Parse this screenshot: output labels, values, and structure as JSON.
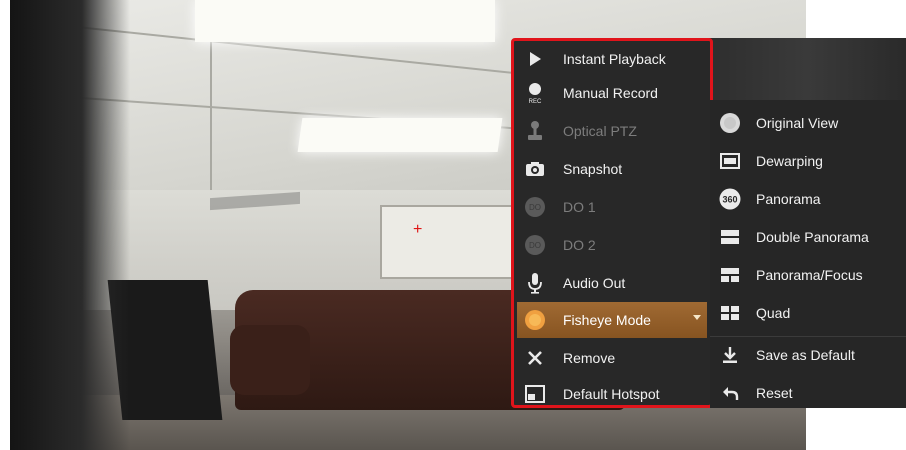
{
  "menu": {
    "items": [
      {
        "label": "Instant Playback",
        "icon": "play-icon",
        "enabled": true
      },
      {
        "label": "Manual Record",
        "icon": "record-icon",
        "icon_caption": "REC",
        "enabled": true
      },
      {
        "label": "Optical PTZ",
        "icon": "ptz-joystick-icon",
        "enabled": false
      },
      {
        "label": "Snapshot",
        "icon": "camera-icon",
        "enabled": true
      },
      {
        "label": "DO 1",
        "icon": "digital-output-icon",
        "enabled": false
      },
      {
        "label": "DO 2",
        "icon": "digital-output-icon",
        "enabled": false
      },
      {
        "label": "Audio Out",
        "icon": "microphone-icon",
        "enabled": true
      },
      {
        "label": "Fisheye Mode",
        "icon": "fisheye-icon",
        "enabled": true,
        "active": true,
        "has_submenu": true
      },
      {
        "label": "Remove",
        "icon": "close-icon",
        "enabled": true
      },
      {
        "label": "Default Hotspot",
        "icon": "hotspot-icon",
        "enabled": true
      }
    ],
    "highlight_color": "#e0141b",
    "active_color": "#9a6430"
  },
  "submenu": {
    "items": [
      {
        "label": "Original View",
        "icon": "original-view-icon"
      },
      {
        "label": "Dewarping",
        "icon": "dewarping-icon"
      },
      {
        "label": "Panorama",
        "icon": "panorama-360-icon",
        "icon_caption": "360"
      },
      {
        "label": "Double Panorama",
        "icon": "double-panorama-icon"
      },
      {
        "label": "Panorama/Focus",
        "icon": "panorama-focus-icon"
      },
      {
        "label": "Quad",
        "icon": "quad-icon"
      },
      {
        "label": "Save as Default",
        "icon": "download-icon"
      },
      {
        "label": "Reset",
        "icon": "reset-icon"
      }
    ]
  }
}
